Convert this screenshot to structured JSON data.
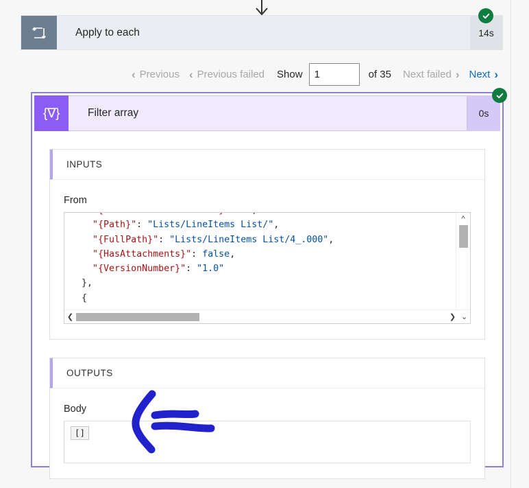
{
  "connector": {
    "icon": "arrow-down-icon"
  },
  "apply_to_each": {
    "icon": "loop-repeat-icon",
    "title": "Apply to each",
    "duration": "14s",
    "status": "succeeded",
    "status_icon": "check-circle-icon"
  },
  "pagination": {
    "previous": "Previous",
    "previous_failed": "Previous failed",
    "show_label": "Show",
    "page_value": "1",
    "page_placeholder": "",
    "of_label": "of 35",
    "total_pages": 35,
    "next_failed": "Next failed",
    "next": "Next",
    "chevron_left": "‹",
    "chevron_right": "›"
  },
  "filter_array": {
    "icon": "filter-braces-icon",
    "icon_glyph": "{∇}",
    "title": "Filter array",
    "duration": "0s",
    "status": "succeeded",
    "status_icon": "check-circle-icon"
  },
  "inputs": {
    "header": "INPUTS",
    "from_label": "From",
    "code_lines": [
      {
        "indent": 4,
        "key": "\"{FilenameWithExtension}\"",
        "value": "\"\"",
        "value_type": "string",
        "comma": true
      },
      {
        "indent": 4,
        "key": "\"{Path}\"",
        "value": "\"Lists/LineItems List/\"",
        "value_type": "string",
        "comma": true
      },
      {
        "indent": 4,
        "key": "\"{FullPath}\"",
        "value": "\"Lists/LineItems List/4_.000\"",
        "value_type": "string",
        "comma": true
      },
      {
        "indent": 4,
        "key": "\"{HasAttachments}\"",
        "value": "false",
        "value_type": "bool",
        "comma": true
      },
      {
        "indent": 4,
        "key": "\"{VersionNumber}\"",
        "value": "\"1.0\"",
        "value_type": "string",
        "comma": false
      },
      {
        "indent": 2,
        "key": "",
        "value": "},",
        "value_type": "punct",
        "comma": false
      },
      {
        "indent": 2,
        "key": "",
        "value": "{",
        "value_type": "punct",
        "comma": false
      }
    ],
    "scrollbar": {
      "up_icon": "chevron-up-icon",
      "down_icon": "chevron-down-icon",
      "left_icon": "chevron-left-icon",
      "right_icon": "chevron-right-icon"
    }
  },
  "outputs": {
    "header": "OUTPUTS",
    "body_label": "Body",
    "body_value": "[]"
  },
  "annotation": {
    "shape": "hand-drawn-left-arrow",
    "color": "#2222cc"
  },
  "colors": {
    "accent_purple": "#8b5cf6",
    "card_border": "#8b80d8",
    "success_green": "#107c41",
    "link_blue": "#0f6cbd",
    "json_key": "#a31515",
    "json_string": "#0451a5",
    "annotation_blue": "#2222cc"
  }
}
